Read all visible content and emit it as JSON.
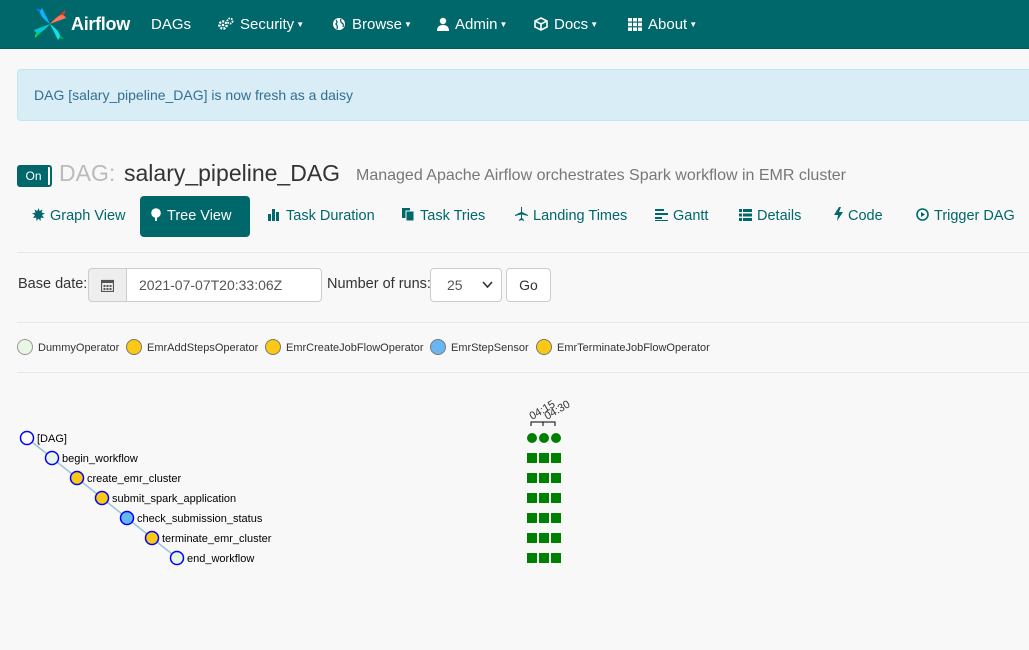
{
  "navbar": {
    "brand": "Airflow",
    "items": [
      {
        "label": "DAGs"
      },
      {
        "label": "Security"
      },
      {
        "label": "Browse"
      },
      {
        "label": "Admin"
      },
      {
        "label": "Docs"
      },
      {
        "label": "About"
      }
    ]
  },
  "alert": {
    "message": "DAG [salary_pipeline_DAG] is now fresh as a daisy"
  },
  "dag": {
    "toggle_label": "On",
    "prefix": "DAG:",
    "id": "salary_pipeline_DAG",
    "description": "Managed Apache Airflow orchestrates Spark workflow in EMR cluster"
  },
  "tabs": [
    {
      "label": "Graph View",
      "icon": "sun-icon"
    },
    {
      "label": "Tree View",
      "icon": "tree-icon",
      "active": true
    },
    {
      "label": "Task Duration",
      "icon": "bar-chart-icon"
    },
    {
      "label": "Task Tries",
      "icon": "files-icon"
    },
    {
      "label": "Landing Times",
      "icon": "plane-icon"
    },
    {
      "label": "Gantt",
      "icon": "align-left-icon"
    },
    {
      "label": "Details",
      "icon": "list-icon"
    },
    {
      "label": "Code",
      "icon": "flash-icon"
    },
    {
      "label": "Trigger DAG",
      "icon": "play-circle-icon"
    }
  ],
  "form": {
    "base_date_label": "Base date:",
    "base_date_value": "2021-07-07T20:33:06Z",
    "num_runs_label": "Number of runs:",
    "num_runs_value": "25",
    "go_label": "Go"
  },
  "legend": [
    {
      "label": "DummyOperator",
      "color": "#e8f7e4"
    },
    {
      "label": "EmrAddStepsOperator",
      "color": "#f9c915"
    },
    {
      "label": "EmrCreateJobFlowOperator",
      "color": "#f9c915"
    },
    {
      "label": "EmrStepSensor",
      "color": "#68b7f3"
    },
    {
      "label": "EmrTerminateJobFlowOperator",
      "color": "#f9c915"
    }
  ],
  "tree": {
    "time_ticks": [
      "04:15",
      "04:30"
    ],
    "nodes": [
      {
        "label": "[DAG]",
        "color": "#ffffff",
        "runs": [
          "success",
          "success",
          "success"
        ]
      },
      {
        "label": "begin_workflow",
        "color": "#e8f7e4",
        "runs": [
          "success",
          "success",
          "success"
        ]
      },
      {
        "label": "create_emr_cluster",
        "color": "#f9c915",
        "runs": [
          "success",
          "success",
          "success"
        ]
      },
      {
        "label": "submit_spark_application",
        "color": "#f9c915",
        "runs": [
          "success",
          "success",
          "success"
        ]
      },
      {
        "label": "check_submission_status",
        "color": "#68b7f3",
        "runs": [
          "success",
          "success",
          "success"
        ]
      },
      {
        "label": "terminate_emr_cluster",
        "color": "#f9c915",
        "runs": [
          "success",
          "success",
          "success"
        ]
      },
      {
        "label": "end_workflow",
        "color": "#e8f7e4",
        "runs": [
          "success",
          "success",
          "success"
        ]
      }
    ],
    "status_colors": {
      "success": "#008000"
    }
  }
}
